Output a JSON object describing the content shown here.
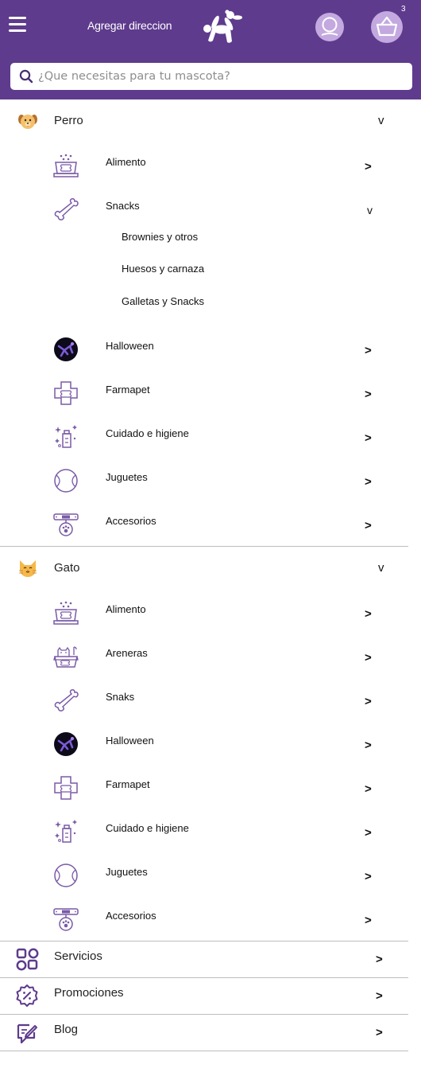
{
  "header": {
    "address_label": "Agregar direccion",
    "cart_count": "3",
    "icons": {
      "menu": "hamburger-icon",
      "logo": "balloon-dog-logo",
      "user": "user-icon",
      "cart": "basket-icon"
    },
    "colors": {
      "primary": "#5e3b8d",
      "icon_bg": "#c3a9e0",
      "icon_stroke": "#7a5aa6"
    }
  },
  "search": {
    "placeholder": "¿Que necesitas para tu mascota?"
  },
  "perro": {
    "label": "Perro",
    "expand": "v",
    "items": [
      {
        "label": "Alimento",
        "arrow": ">"
      },
      {
        "label": "Snacks",
        "arrow": "v",
        "subitems": [
          "Brownies y otros",
          "Huesos y carnaza",
          "Galletas y Snacks"
        ]
      },
      {
        "label": "Halloween",
        "arrow": ">"
      },
      {
        "label": "Farmapet",
        "arrow": ">"
      },
      {
        "label": "Cuidado e higiene",
        "arrow": ">"
      },
      {
        "label": "Juguetes",
        "arrow": ">"
      },
      {
        "label": "Accesorios",
        "arrow": ">"
      }
    ]
  },
  "gato": {
    "label": "Gato",
    "expand": "v",
    "items": [
      {
        "label": "Alimento",
        "arrow": ">"
      },
      {
        "label": "Areneras",
        "arrow": ">"
      },
      {
        "label": "Snaks",
        "arrow": ">"
      },
      {
        "label": "Halloween",
        "arrow": ">"
      },
      {
        "label": "Farmapet",
        "arrow": ">"
      },
      {
        "label": "Cuidado e higiene",
        "arrow": ">"
      },
      {
        "label": "Juguetes",
        "arrow": ">"
      },
      {
        "label": "Accesorios",
        "arrow": ">"
      }
    ]
  },
  "bottom": [
    {
      "label": "Servicios",
      "arrow": ">"
    },
    {
      "label": "Promociones",
      "arrow": ">"
    },
    {
      "label": "Blog",
      "arrow": ">"
    }
  ]
}
